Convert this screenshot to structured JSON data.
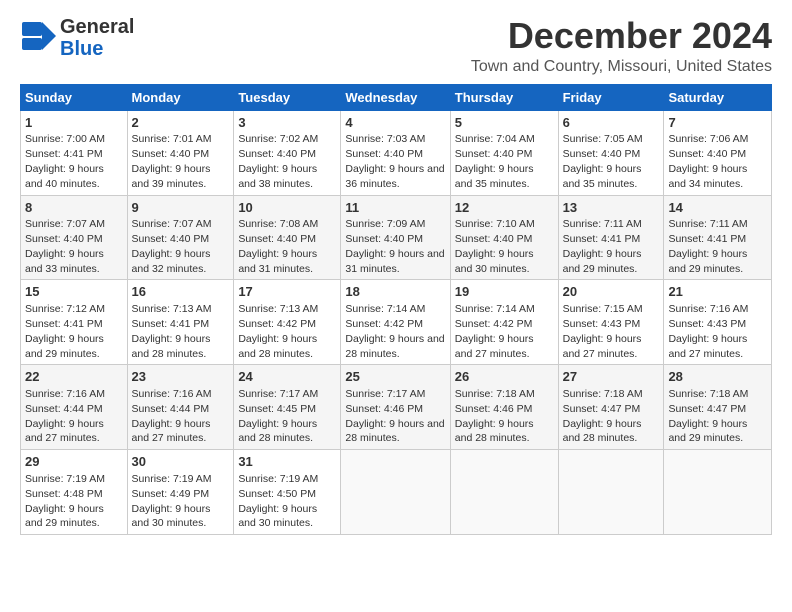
{
  "header": {
    "logo_line1": "General",
    "logo_line2": "Blue",
    "month": "December 2024",
    "location": "Town and Country, Missouri, United States"
  },
  "days_of_week": [
    "Sunday",
    "Monday",
    "Tuesday",
    "Wednesday",
    "Thursday",
    "Friday",
    "Saturday"
  ],
  "weeks": [
    [
      {
        "day": "1",
        "sunrise": "7:00 AM",
        "sunset": "4:41 PM",
        "daylight": "9 hours and 40 minutes."
      },
      {
        "day": "2",
        "sunrise": "7:01 AM",
        "sunset": "4:40 PM",
        "daylight": "9 hours and 39 minutes."
      },
      {
        "day": "3",
        "sunrise": "7:02 AM",
        "sunset": "4:40 PM",
        "daylight": "9 hours and 38 minutes."
      },
      {
        "day": "4",
        "sunrise": "7:03 AM",
        "sunset": "4:40 PM",
        "daylight": "9 hours and 36 minutes."
      },
      {
        "day": "5",
        "sunrise": "7:04 AM",
        "sunset": "4:40 PM",
        "daylight": "9 hours and 35 minutes."
      },
      {
        "day": "6",
        "sunrise": "7:05 AM",
        "sunset": "4:40 PM",
        "daylight": "9 hours and 35 minutes."
      },
      {
        "day": "7",
        "sunrise": "7:06 AM",
        "sunset": "4:40 PM",
        "daylight": "9 hours and 34 minutes."
      }
    ],
    [
      {
        "day": "8",
        "sunrise": "7:07 AM",
        "sunset": "4:40 PM",
        "daylight": "9 hours and 33 minutes."
      },
      {
        "day": "9",
        "sunrise": "7:07 AM",
        "sunset": "4:40 PM",
        "daylight": "9 hours and 32 minutes."
      },
      {
        "day": "10",
        "sunrise": "7:08 AM",
        "sunset": "4:40 PM",
        "daylight": "9 hours and 31 minutes."
      },
      {
        "day": "11",
        "sunrise": "7:09 AM",
        "sunset": "4:40 PM",
        "daylight": "9 hours and 31 minutes."
      },
      {
        "day": "12",
        "sunrise": "7:10 AM",
        "sunset": "4:40 PM",
        "daylight": "9 hours and 30 minutes."
      },
      {
        "day": "13",
        "sunrise": "7:11 AM",
        "sunset": "4:41 PM",
        "daylight": "9 hours and 29 minutes."
      },
      {
        "day": "14",
        "sunrise": "7:11 AM",
        "sunset": "4:41 PM",
        "daylight": "9 hours and 29 minutes."
      }
    ],
    [
      {
        "day": "15",
        "sunrise": "7:12 AM",
        "sunset": "4:41 PM",
        "daylight": "9 hours and 29 minutes."
      },
      {
        "day": "16",
        "sunrise": "7:13 AM",
        "sunset": "4:41 PM",
        "daylight": "9 hours and 28 minutes."
      },
      {
        "day": "17",
        "sunrise": "7:13 AM",
        "sunset": "4:42 PM",
        "daylight": "9 hours and 28 minutes."
      },
      {
        "day": "18",
        "sunrise": "7:14 AM",
        "sunset": "4:42 PM",
        "daylight": "9 hours and 28 minutes."
      },
      {
        "day": "19",
        "sunrise": "7:14 AM",
        "sunset": "4:42 PM",
        "daylight": "9 hours and 27 minutes."
      },
      {
        "day": "20",
        "sunrise": "7:15 AM",
        "sunset": "4:43 PM",
        "daylight": "9 hours and 27 minutes."
      },
      {
        "day": "21",
        "sunrise": "7:16 AM",
        "sunset": "4:43 PM",
        "daylight": "9 hours and 27 minutes."
      }
    ],
    [
      {
        "day": "22",
        "sunrise": "7:16 AM",
        "sunset": "4:44 PM",
        "daylight": "9 hours and 27 minutes."
      },
      {
        "day": "23",
        "sunrise": "7:16 AM",
        "sunset": "4:44 PM",
        "daylight": "9 hours and 27 minutes."
      },
      {
        "day": "24",
        "sunrise": "7:17 AM",
        "sunset": "4:45 PM",
        "daylight": "9 hours and 28 minutes."
      },
      {
        "day": "25",
        "sunrise": "7:17 AM",
        "sunset": "4:46 PM",
        "daylight": "9 hours and 28 minutes."
      },
      {
        "day": "26",
        "sunrise": "7:18 AM",
        "sunset": "4:46 PM",
        "daylight": "9 hours and 28 minutes."
      },
      {
        "day": "27",
        "sunrise": "7:18 AM",
        "sunset": "4:47 PM",
        "daylight": "9 hours and 28 minutes."
      },
      {
        "day": "28",
        "sunrise": "7:18 AM",
        "sunset": "4:47 PM",
        "daylight": "9 hours and 29 minutes."
      }
    ],
    [
      {
        "day": "29",
        "sunrise": "7:19 AM",
        "sunset": "4:48 PM",
        "daylight": "9 hours and 29 minutes."
      },
      {
        "day": "30",
        "sunrise": "7:19 AM",
        "sunset": "4:49 PM",
        "daylight": "9 hours and 30 minutes."
      },
      {
        "day": "31",
        "sunrise": "7:19 AM",
        "sunset": "4:50 PM",
        "daylight": "9 hours and 30 minutes."
      },
      null,
      null,
      null,
      null
    ]
  ]
}
